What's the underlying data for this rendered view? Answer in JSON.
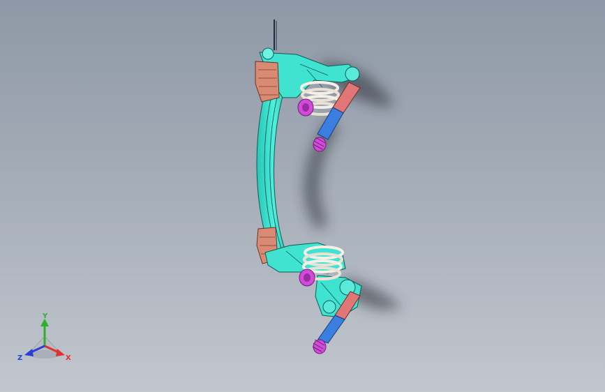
{
  "viewport": {
    "background_top": "#8e98a6",
    "background_bottom": "#c2c7ce"
  },
  "model": {
    "body_color": "#3fe3d0",
    "spring_color": "#f4f0e6",
    "pad_color": "#d24bd8",
    "damper_color": "#3a7fe0",
    "bracket_color": "#d98a72",
    "shadow_color": "#2a2f38"
  },
  "triad": {
    "x_label": "X",
    "y_label": "Y",
    "z_label": "Z",
    "x_color": "#e03030",
    "y_color": "#2bb02b",
    "z_color": "#2a3fd8"
  }
}
